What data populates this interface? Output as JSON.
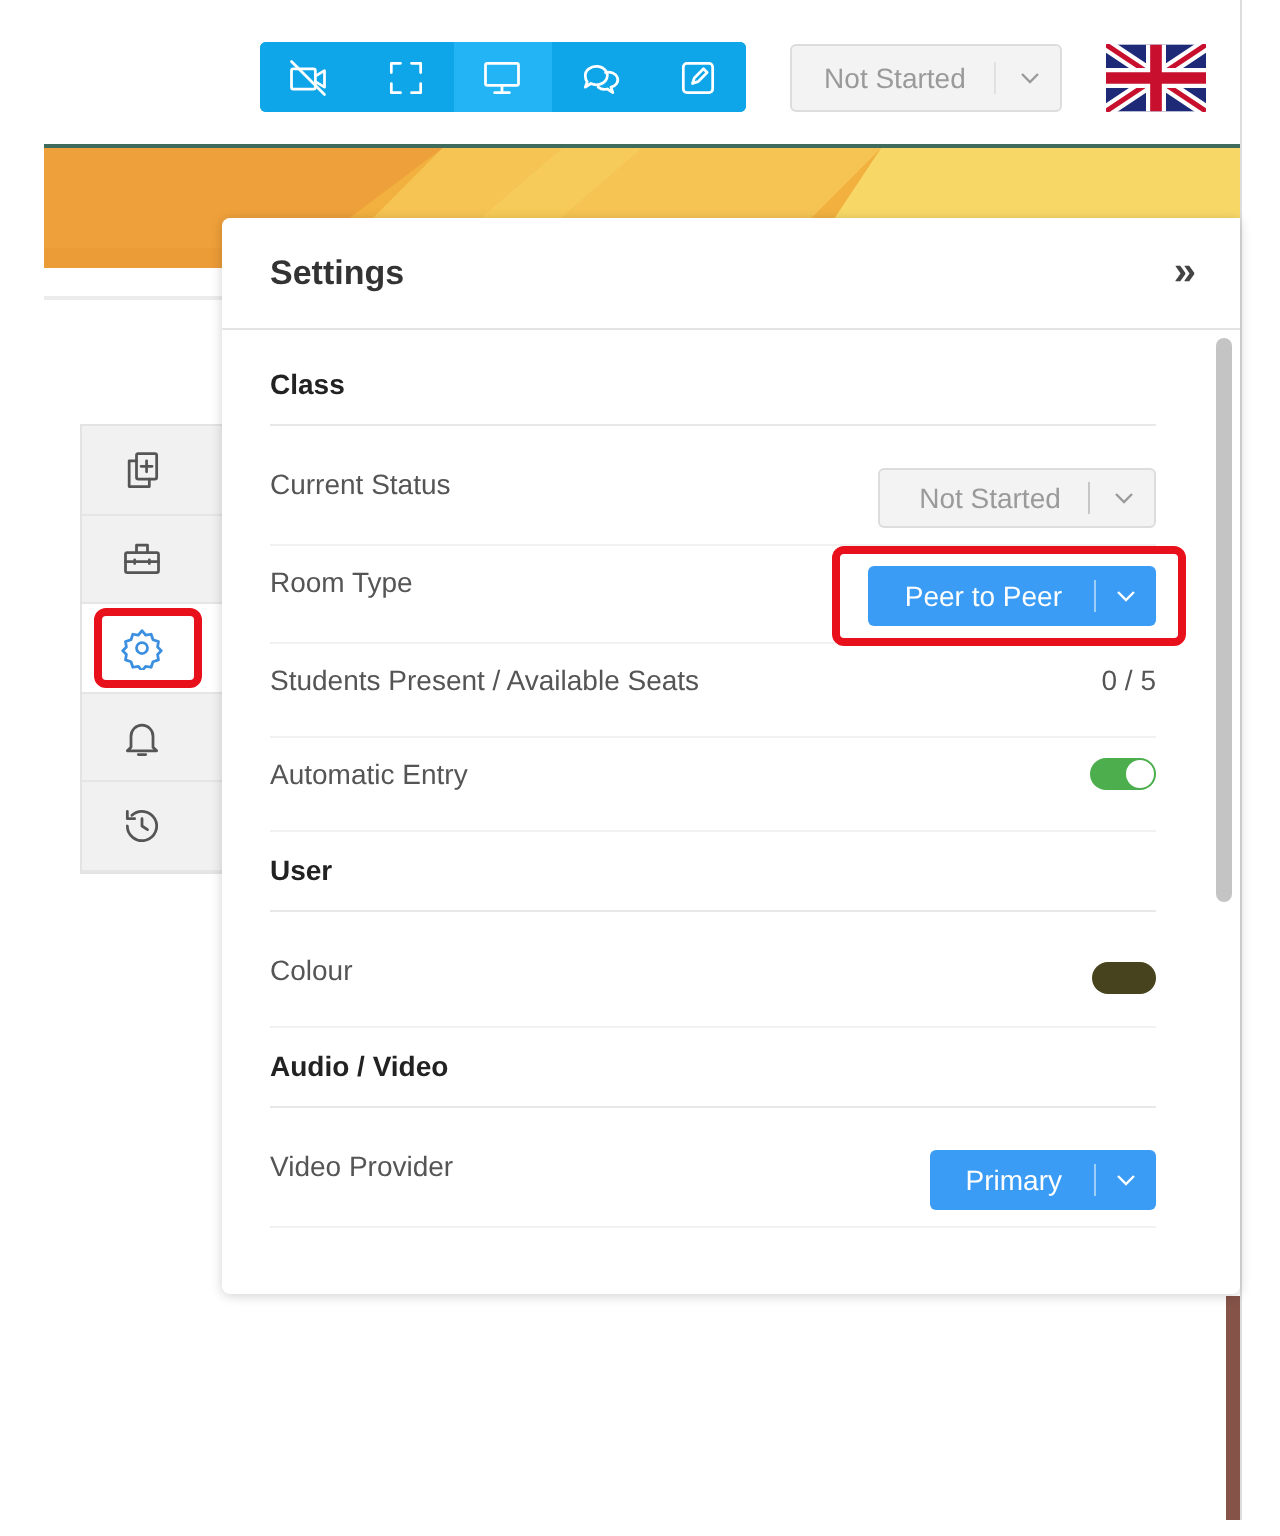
{
  "toolbar": {
    "buttons": [
      {
        "kind": "video-off",
        "selected": false
      },
      {
        "kind": "fullscreen",
        "selected": false
      },
      {
        "kind": "screen",
        "selected": true
      },
      {
        "kind": "chat",
        "selected": false
      },
      {
        "kind": "edit",
        "selected": false
      }
    ]
  },
  "status_select": {
    "value": "Not Started",
    "disabled": true
  },
  "side_rail": {
    "items": [
      {
        "kind": "add-page",
        "selected": false,
        "highlighted": false
      },
      {
        "kind": "toolbox",
        "selected": false,
        "highlighted": false
      },
      {
        "kind": "settings",
        "selected": true,
        "highlighted": true
      },
      {
        "kind": "bell",
        "selected": false,
        "highlighted": false
      },
      {
        "kind": "history",
        "selected": false,
        "highlighted": false
      }
    ]
  },
  "settings": {
    "title": "Settings",
    "collapse": "»",
    "sections": [
      {
        "title": "Class",
        "rows": [
          {
            "kind": "select",
            "label": "Current Status",
            "value": "Not Started",
            "disabled": true,
            "highlighted": false
          },
          {
            "kind": "select",
            "label": "Room Type",
            "value": "Peer to Peer",
            "disabled": false,
            "highlighted": true
          },
          {
            "kind": "text",
            "label": "Students Present / Available Seats",
            "value": "0 / 5"
          },
          {
            "kind": "toggle",
            "label": "Automatic Entry",
            "on": true
          }
        ]
      },
      {
        "title": "User",
        "rows": [
          {
            "kind": "swatch",
            "label": "Colour",
            "color": "#48431f"
          }
        ]
      },
      {
        "title": "Audio / Video",
        "rows": [
          {
            "kind": "select",
            "label": "Video Provider",
            "value": "Primary",
            "disabled": false,
            "highlighted": false
          }
        ]
      }
    ]
  }
}
